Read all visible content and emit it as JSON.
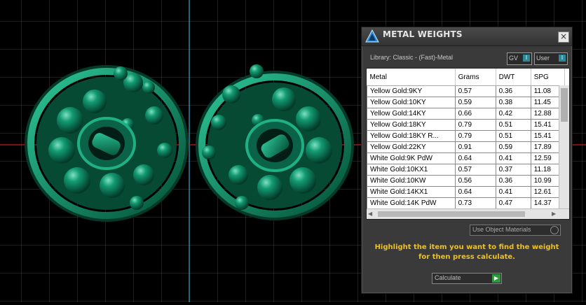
{
  "panel": {
    "title": "METAL WEIGHTS",
    "close_glyph": "×",
    "library_text": "Library: Classic - (Fast)-Metal",
    "gv_label": "GV",
    "user_label": "User",
    "toggle_glyph": "I",
    "columns": [
      "Metal",
      "Grams",
      "DWT",
      "SPG"
    ],
    "rows": [
      {
        "metal": "Yellow Gold:9KY",
        "grams": "0.57",
        "dwt": "0.36",
        "spg": "11.08"
      },
      {
        "metal": "Yellow Gold:10KY",
        "grams": "0.59",
        "dwt": "0.38",
        "spg": "11.45"
      },
      {
        "metal": "Yellow Gold:14KY",
        "grams": "0.66",
        "dwt": "0.42",
        "spg": "12.88"
      },
      {
        "metal": "Yellow Gold:18KY",
        "grams": "0.79",
        "dwt": "0.51",
        "spg": "15.41"
      },
      {
        "metal": "Yellow Gold:18KY R...",
        "grams": "0.79",
        "dwt": "0.51",
        "spg": "15.41"
      },
      {
        "metal": "Yellow Gold:22KY",
        "grams": "0.91",
        "dwt": "0.59",
        "spg": "17.89"
      },
      {
        "metal": "White Gold:9K PdW",
        "grams": "0.64",
        "dwt": "0.41",
        "spg": "12.59"
      },
      {
        "metal": "White Gold:10KX1",
        "grams": "0.57",
        "dwt": "0.37",
        "spg": "11.18"
      },
      {
        "metal": "White Gold:10KW",
        "grams": "0.56",
        "dwt": "0.36",
        "spg": "10.99"
      },
      {
        "metal": "White Gold:14KX1",
        "grams": "0.64",
        "dwt": "0.41",
        "spg": "12.61"
      },
      {
        "metal": "White Gold:14K PdW",
        "grams": "0.73",
        "dwt": "0.47",
        "spg": "14.37"
      }
    ],
    "use_object_materials": "Use Object Materials",
    "hint": "Highlight the item you want to find the weight for then press calculate.",
    "calculate_label": "Calculate",
    "calculate_glyph": "▶"
  },
  "colors": {
    "grid_line": "#3a3a3a",
    "axis_vertical": "#3aa6c4",
    "axis_horizontal": "#c41d1d",
    "model_green": "#0f7a5c",
    "hint_text": "#f2c01a"
  }
}
